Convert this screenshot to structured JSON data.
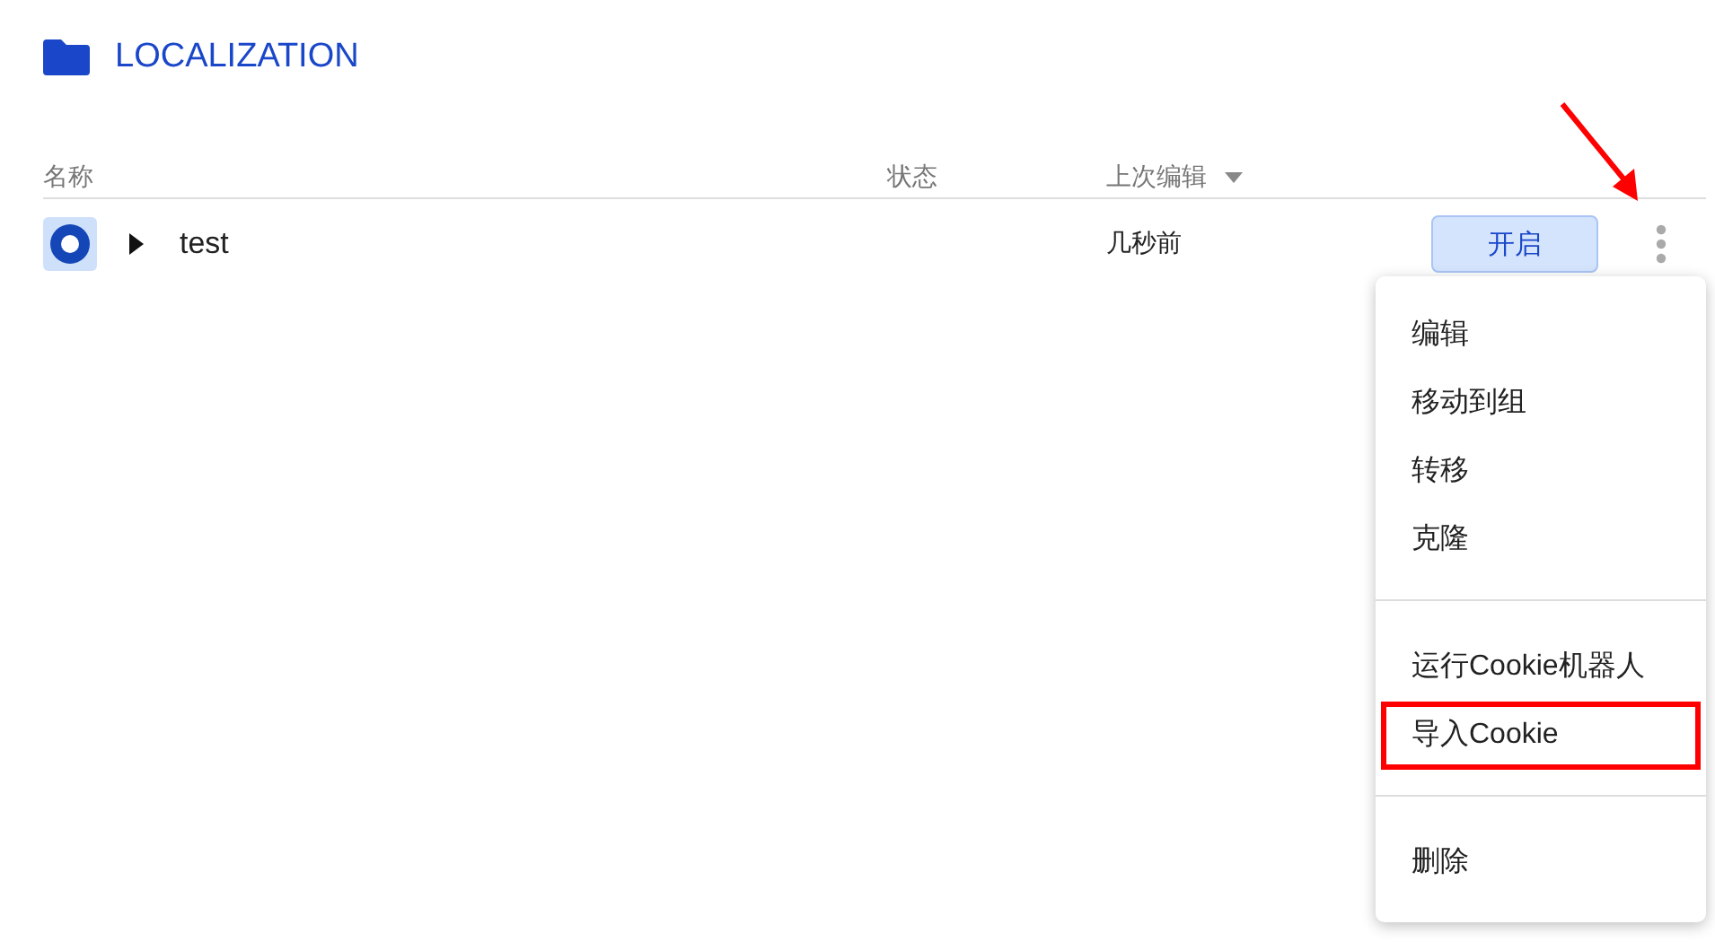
{
  "folder": {
    "title": "LOCALIZATION"
  },
  "table": {
    "columns": [
      {
        "label": "名称",
        "sorted": false
      },
      {
        "label": "状态",
        "sorted": false
      },
      {
        "label": "上次编辑",
        "sorted": true
      }
    ],
    "rows": [
      {
        "name": "test",
        "expanded": false,
        "last_edited": "几秒前",
        "action": "开启"
      }
    ]
  },
  "menu": {
    "groups": [
      [
        {
          "label": "编辑",
          "highlighted": false
        },
        {
          "label": "移动到组",
          "highlighted": false
        },
        {
          "label": "转移",
          "highlighted": false
        },
        {
          "label": "克隆",
          "highlighted": false
        }
      ],
      [
        {
          "label": "运行Cookie机器人",
          "highlighted": false
        },
        {
          "label": "导入Cookie",
          "highlighted": true
        }
      ],
      [
        {
          "label": "删除",
          "highlighted": false
        }
      ]
    ]
  }
}
